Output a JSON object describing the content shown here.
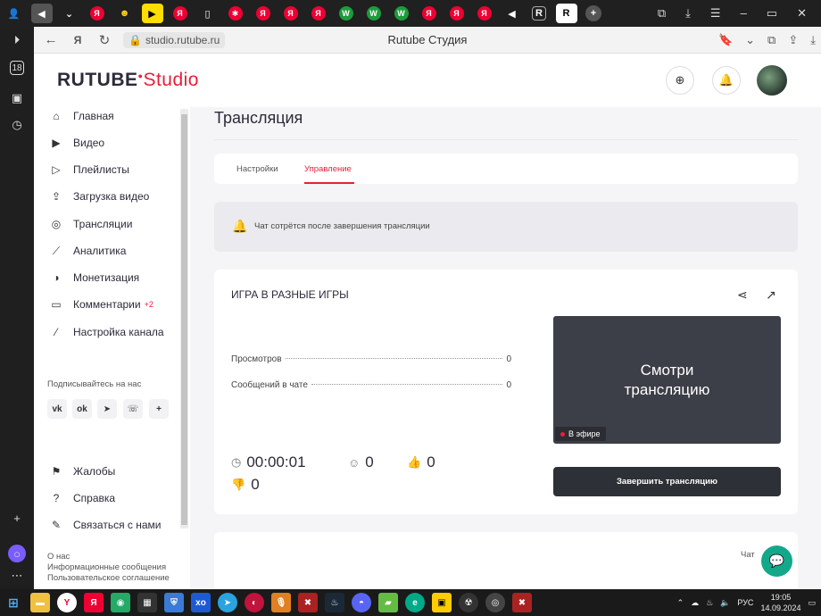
{
  "browser": {
    "url": "studio.rutube.ru",
    "page_title": "Rutube Студия"
  },
  "brand": {
    "logo_main": "RUTUBE",
    "logo_studio": "Studio",
    "accent_color": "#e5203a",
    "action_color": "#14a88b"
  },
  "sidebar": {
    "items": [
      {
        "label": "Главная",
        "icon": "home-icon"
      },
      {
        "label": "Видео",
        "icon": "video-icon"
      },
      {
        "label": "Плейлисты",
        "icon": "playlist-icon"
      },
      {
        "label": "Загрузка видео",
        "icon": "upload-icon"
      },
      {
        "label": "Трансляции",
        "icon": "broadcast-icon"
      },
      {
        "label": "Аналитика",
        "icon": "analytics-icon"
      },
      {
        "label": "Монетизация",
        "icon": "monetization-icon"
      },
      {
        "label": "Комментарии",
        "icon": "comments-icon",
        "badge": "+2"
      },
      {
        "label": "Настройка канала",
        "icon": "wand-icon"
      }
    ],
    "follow_label": "Подписывайтесь на нас",
    "socials": [
      "vk",
      "ok",
      "telegram",
      "viber",
      "more"
    ],
    "bottom_items": [
      {
        "label": "Жалобы",
        "icon": "flag-icon"
      },
      {
        "label": "Справка",
        "icon": "help-icon"
      },
      {
        "label": "Связаться с нами",
        "icon": "edit-icon"
      }
    ],
    "footer_links": [
      "О нас",
      "Информационные сообщения",
      "Пользовательское соглашение"
    ]
  },
  "main": {
    "title": "Трансляция",
    "tabs": [
      {
        "label": "Настройки",
        "active": false
      },
      {
        "label": "Управление",
        "active": true
      }
    ],
    "notice": "Чат сотрётся после завершения трансляции",
    "stream": {
      "name": "ИГРА В РАЗНЫЕ ИГРЫ",
      "stats": [
        {
          "label": "Просмотров",
          "value": "0"
        },
        {
          "label": "Сообщений в чате",
          "value": "0"
        }
      ],
      "preview_text_line1": "Смотри",
      "preview_text_line2": "трансляцию",
      "live_label": "В эфире",
      "end_button": "Завершить трансляцию",
      "duration": "00:00:01",
      "viewers": "0",
      "likes": "0",
      "dislikes": "0"
    },
    "chat_label": "Чат"
  },
  "taskbar": {
    "lang": "РУС",
    "time": "19:05",
    "date": "14.09.2024"
  }
}
